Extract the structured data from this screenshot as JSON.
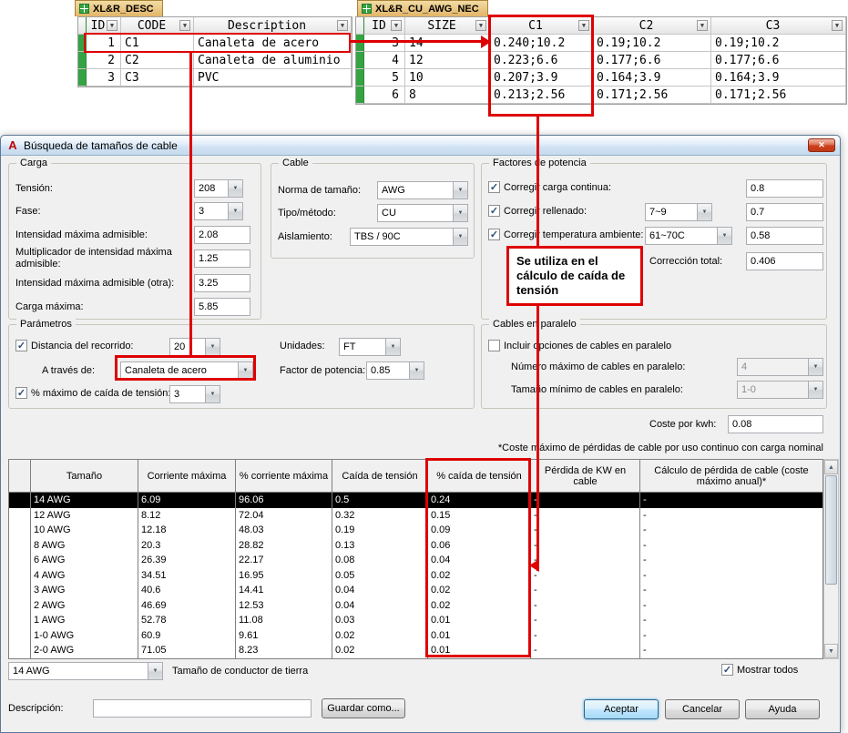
{
  "colors": {
    "annotation-red": "#DE0101",
    "selection-bg": "#000000",
    "icon-green": "#35A343"
  },
  "icons": {
    "autocad": "A",
    "close": "✕",
    "dropdown": "▼",
    "check": "✓",
    "scroll_up": "▲",
    "scroll_down": "▼"
  },
  "desc_sheet": {
    "tab_label": "XL&R_DESC",
    "columns": [
      "ID",
      "CODE",
      "Description"
    ],
    "rows": [
      [
        "1",
        "C1",
        "Canaleta de acero"
      ],
      [
        "2",
        "C2",
        "Canaleta de aluminio"
      ],
      [
        "3",
        "C3",
        "PVC"
      ]
    ]
  },
  "awg_sheet": {
    "tab_label": "XL&R_CU_AWG_NEC",
    "columns": [
      "ID",
      "SIZE",
      "C1",
      "C2",
      "C3"
    ],
    "rows": [
      [
        "3",
        "14",
        "0.240;10.2",
        "0.19;10.2",
        "0.19;10.2"
      ],
      [
        "4",
        "12",
        "0.223;6.6",
        "0.177;6.6",
        "0.177;6.6"
      ],
      [
        "5",
        "10",
        "0.207;3.9",
        "0.164;3.9",
        "0.164;3.9"
      ],
      [
        "6",
        "8",
        "0.213;2.56",
        "0.171;2.56",
        "0.171;2.56"
      ]
    ]
  },
  "callout": {
    "text": "Se utiliza en el cálculo de caída de tensión"
  },
  "dialog": {
    "title": "Búsqueda de tamaños de cable",
    "carga": {
      "caption": "Carga",
      "tension_label": "Tensión:",
      "tension_value": "208",
      "fase_label": "Fase:",
      "fase_value": "3",
      "intensidad_label": "Intensidad máxima admisible:",
      "intensidad_value": "2.08",
      "multiplicador_label": "Multiplicador de intensidad máxima admisible:",
      "multiplicador_value": "1.25",
      "intensidad_otra_label": "Intensidad máxima admisible (otra):",
      "intensidad_otra_value": "3.25",
      "carga_maxima_label": "Carga máxima:",
      "carga_maxima_value": "5.85"
    },
    "cable": {
      "caption": "Cable",
      "norma_label": "Norma de tamaño:",
      "norma_value": "AWG",
      "tipo_label": "Tipo/método:",
      "tipo_value": "CU",
      "aislamiento_label": "Aislamiento:",
      "aislamiento_value": "TBS / 90C"
    },
    "factores": {
      "caption": "Factores de potencia",
      "carga_continua_label": "Corregir carga continua:",
      "carga_continua_value": "0.8",
      "rellenado_label": "Corregir rellenado:",
      "rellenado_option": "7~9",
      "rellenado_value": "0.7",
      "temperatura_label": "Corregir temperatura ambiente:",
      "temperatura_option": "61~70C",
      "temperatura_value": "0.58",
      "correccion_label": "Corrección total:",
      "correccion_value": "0.406"
    },
    "parametros": {
      "caption": "Parámetros",
      "distancia_label": "Distancia del recorrido:",
      "distancia_value": "20",
      "unidades_label": "Unidades:",
      "unidades_value": "FT",
      "atraves_label": "A través de:",
      "atraves_value": "Canaleta de acero",
      "factor_label": "Factor de potencia:",
      "factor_value": "0.85",
      "caida_label": "% máximo de caída de tensión:",
      "caida_value": "3"
    },
    "paralelo": {
      "caption": "Cables en paralelo",
      "incluir_label": "Incluir opciones de cables en paralelo",
      "numero_label": "Número máximo de cables en paralelo:",
      "numero_value": "4",
      "tamano_min_label": "Tamaño mínimo de cables en paralelo:",
      "tamano_min_value": "1-0"
    },
    "coste_label": "Coste por kwh:",
    "coste_value": "0.08",
    "coste_note": "*Coste máximo de pérdidas de cable por uso continuo con carga nominal",
    "results": {
      "columns": [
        "Tamaño",
        "Corriente máxima",
        "% corriente máxima",
        "Caída de tensión",
        "% caída de tensión",
        "Pérdida de KW en cable",
        "Cálculo de pérdida de cable (coste máximo anual)*"
      ],
      "selected_row": 0,
      "rows": [
        [
          "14 AWG",
          "6.09",
          "96.06",
          "0.5",
          "0.24",
          "-",
          "-"
        ],
        [
          "12 AWG",
          "8.12",
          "72.04",
          "0.32",
          "0.15",
          "-",
          "-"
        ],
        [
          "10 AWG",
          "12.18",
          "48.03",
          "0.19",
          "0.09",
          "-",
          "-"
        ],
        [
          "8 AWG",
          "20.3",
          "28.82",
          "0.13",
          "0.06",
          "-",
          "-"
        ],
        [
          "6 AWG",
          "26.39",
          "22.17",
          "0.08",
          "0.04",
          "-",
          "-"
        ],
        [
          "4 AWG",
          "34.51",
          "16.95",
          "0.05",
          "0.02",
          "-",
          "-"
        ],
        [
          "3 AWG",
          "40.6",
          "14.41",
          "0.04",
          "0.02",
          "-",
          "-"
        ],
        [
          "2 AWG",
          "46.69",
          "12.53",
          "0.04",
          "0.02",
          "-",
          "-"
        ],
        [
          "1 AWG",
          "52.78",
          "11.08",
          "0.03",
          "0.01",
          "-",
          "-"
        ],
        [
          "1-0 AWG",
          "60.9",
          "9.61",
          "0.02",
          "0.01",
          "-",
          "-"
        ],
        [
          "2-0 AWG",
          "71.05",
          "8.23",
          "0.02",
          "0.01",
          "-",
          "-"
        ]
      ]
    },
    "footer": {
      "tierra_value": "14 AWG",
      "tierra_label": "Tamaño de conductor de tierra",
      "mostrar_label": "Mostrar todos",
      "descripcion_label": "Descripción:",
      "descripcion_value": "",
      "guardar_label": "Guardar como...",
      "aceptar_label": "Aceptar",
      "cancelar_label": "Cancelar",
      "ayuda_label": "Ayuda"
    }
  }
}
